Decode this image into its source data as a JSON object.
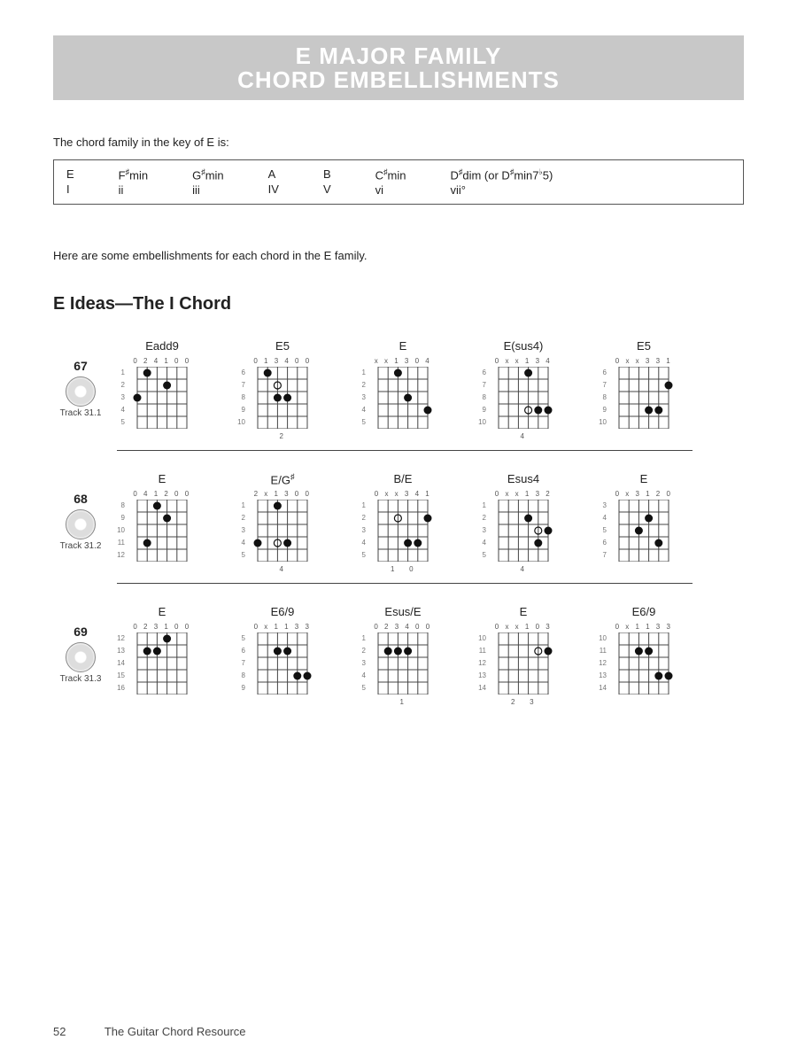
{
  "banner_line1": "E MAJOR FAMILY",
  "banner_line2": "CHORD EMBELLISHMENTS",
  "intro_text": "The chord family in the key of E is:",
  "family": [
    {
      "chord": "E",
      "roman": "I"
    },
    {
      "chord": "F♯min",
      "roman": "ii"
    },
    {
      "chord": "G♯min",
      "roman": "iii"
    },
    {
      "chord": "A",
      "roman": "IV"
    },
    {
      "chord": "B",
      "roman": "V"
    },
    {
      "chord": "C♯min",
      "roman": "vi"
    },
    {
      "chord": "D♯dim (or D♯min7♭5)",
      "roman": "vii°"
    }
  ],
  "sub_intro": "Here are some embellishments for each chord in the E family.",
  "section_title": "E Ideas—The I Chord",
  "rows": [
    {
      "num": "67",
      "track": "Track 31.1",
      "diagrams": [
        {
          "name": "Eadd9",
          "top": "0 2 4 1 0 0",
          "frets": [
            "1",
            "2",
            "3",
            "4",
            "5"
          ],
          "bot": "",
          "dots": [
            [
              1,
              1
            ],
            [
              3,
              0
            ],
            [
              2,
              3
            ]
          ]
        },
        {
          "name": "E5",
          "top": "0 1 3 4 0 0",
          "frets": [
            "6",
            "7",
            "8",
            "9",
            "10"
          ],
          "bot": "2",
          "dots": [
            [
              1,
              1
            ],
            [
              3,
              2
            ],
            [
              3,
              3
            ]
          ],
          "open": [
            [
              2,
              2
            ]
          ]
        },
        {
          "name": "E",
          "top": "x x 1 3 0 4",
          "frets": [
            "1",
            "2",
            "3",
            "4",
            "5"
          ],
          "bot": "",
          "dots": [
            [
              1,
              2
            ],
            [
              4,
              5
            ],
            [
              3,
              3
            ]
          ]
        },
        {
          "name": "E(sus4)",
          "top": "0 x x 1 3 4",
          "frets": [
            "6",
            "7",
            "8",
            "9",
            "10"
          ],
          "bot": "4",
          "dots": [
            [
              1,
              3
            ],
            [
              4,
              4
            ],
            [
              4,
              5
            ]
          ],
          "open": [
            [
              4,
              3
            ]
          ]
        },
        {
          "name": "E5",
          "top": "0 x x 3 3 1",
          "frets": [
            "6",
            "7",
            "8",
            "9",
            "10"
          ],
          "bot": "",
          "dots": [
            [
              2,
              5
            ],
            [
              4,
              3
            ],
            [
              4,
              4
            ]
          ]
        }
      ]
    },
    {
      "num": "68",
      "track": "Track 31.2",
      "diagrams": [
        {
          "name": "E",
          "top": "0 4 1 2 0 0",
          "frets": [
            "8",
            "9",
            "10",
            "11",
            "12"
          ],
          "bot": "",
          "dots": [
            [
              1,
              2
            ],
            [
              2,
              3
            ],
            [
              4,
              1
            ]
          ]
        },
        {
          "name": "E/G♯",
          "top": "2 x 1 3 0 0",
          "frets": [
            "1",
            "2",
            "3",
            "4",
            "5"
          ],
          "bot": "4",
          "dots": [
            [
              1,
              2
            ],
            [
              4,
              0
            ],
            [
              4,
              3
            ]
          ],
          "open": [
            [
              4,
              2
            ]
          ]
        },
        {
          "name": "B/E",
          "top": "0 x x 3 4 1",
          "frets": [
            "1",
            "2",
            "3",
            "4",
            "5"
          ],
          "bot": "1   0",
          "dots": [
            [
              2,
              5
            ],
            [
              4,
              3
            ],
            [
              4,
              4
            ]
          ],
          "open": [
            [
              2,
              2
            ]
          ]
        },
        {
          "name": "Esus4",
          "top": "0 x x 1 3 2",
          "frets": [
            "1",
            "2",
            "3",
            "4",
            "5"
          ],
          "bot": "4",
          "dots": [
            [
              2,
              3
            ],
            [
              4,
              4
            ],
            [
              3,
              5
            ]
          ],
          "open": [
            [
              3,
              4
            ]
          ]
        },
        {
          "name": "E",
          "top": "0 x 3 1 2 0",
          "frets": [
            "3",
            "4",
            "5",
            "6",
            "7"
          ],
          "bot": "",
          "dots": [
            [
              2,
              3
            ],
            [
              3,
              2
            ],
            [
              4,
              4
            ]
          ]
        }
      ]
    },
    {
      "num": "69",
      "track": "Track 31.3",
      "diagrams": [
        {
          "name": "E",
          "top": "0 2 3 1 0 0",
          "frets": [
            "12",
            "13",
            "14",
            "15",
            "16"
          ],
          "bot": "",
          "dots": [
            [
              1,
              3
            ],
            [
              2,
              1
            ],
            [
              2,
              2
            ]
          ]
        },
        {
          "name": "E6/9",
          "top": "0 x 1 1 3 3",
          "frets": [
            "5",
            "6",
            "7",
            "8",
            "9"
          ],
          "bot": "",
          "dots": [
            [
              2,
              2
            ],
            [
              2,
              3
            ],
            [
              4,
              4
            ],
            [
              4,
              5
            ]
          ]
        },
        {
          "name": "Esus/E",
          "top": "0 2 3 4 0 0",
          "frets": [
            "1",
            "2",
            "3",
            "4",
            "5"
          ],
          "bot": "1",
          "dots": [
            [
              2,
              1
            ],
            [
              2,
              2
            ],
            [
              2,
              3
            ]
          ]
        },
        {
          "name": "E",
          "top": "0 x x 1 0 3",
          "frets": [
            "10",
            "11",
            "12",
            "13",
            "14"
          ],
          "bot": "2   3",
          "dots": [
            [
              0,
              3
            ],
            [
              2,
              5
            ]
          ],
          "open": [
            [
              2,
              4
            ]
          ]
        },
        {
          "name": "E6/9",
          "top": "0 x 1 1 3 3",
          "frets": [
            "10",
            "11",
            "12",
            "13",
            "14"
          ],
          "bot": "",
          "dots": [
            [
              2,
              2
            ],
            [
              2,
              3
            ],
            [
              4,
              4
            ],
            [
              4,
              5
            ]
          ]
        }
      ]
    }
  ],
  "footer": {
    "page": "52",
    "title": "The Guitar Chord Resource"
  }
}
